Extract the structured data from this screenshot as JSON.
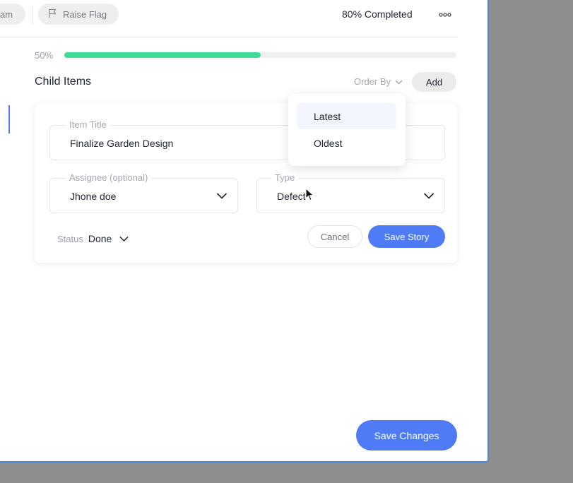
{
  "header": {
    "team_chip_label": "am",
    "raise_flag_label": "Raise Flag",
    "progress_text": "80% Completed",
    "more_icon": "more-dots-icon"
  },
  "progress": {
    "label": "50%",
    "value": 0.5,
    "color": "#3ddc97"
  },
  "child_items": {
    "title": "Child Items",
    "order_by_label": "Order By",
    "add_label": "Add",
    "order_options": [
      {
        "label": "Latest",
        "selected": true
      },
      {
        "label": "Oldest",
        "selected": false
      }
    ]
  },
  "form": {
    "item_title": {
      "label": "Item Title",
      "value": "Finalize Garden Design"
    },
    "assignee": {
      "label": "Assignee (optional)",
      "value": "Jhone doe"
    },
    "type": {
      "label": "Type",
      "value": "Defect"
    },
    "status": {
      "label": "Status",
      "value": "Done"
    },
    "cancel_label": "Cancel",
    "save_label": "Save Story"
  },
  "footer": {
    "save_changes_label": "Save Changes"
  },
  "colors": {
    "accent": "#4f7cf6",
    "progress": "#3ddc97",
    "window_border": "#4a86d8"
  }
}
